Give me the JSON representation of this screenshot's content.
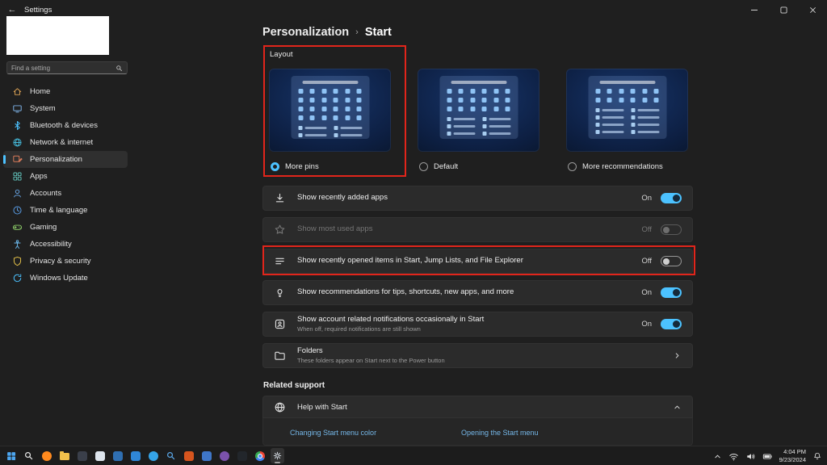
{
  "colors": {
    "accent": "#4cc2ff",
    "link": "#75b7e8",
    "annotation": "#e1251b"
  },
  "titlebar": {
    "title": "Settings"
  },
  "sidebar": {
    "search_placeholder": "Find a setting",
    "items": [
      {
        "label": "Home",
        "icon": "home"
      },
      {
        "label": "System",
        "icon": "system"
      },
      {
        "label": "Bluetooth & devices",
        "icon": "bluetooth"
      },
      {
        "label": "Network & internet",
        "icon": "network"
      },
      {
        "label": "Personalization",
        "icon": "personalization",
        "selected": true
      },
      {
        "label": "Apps",
        "icon": "apps"
      },
      {
        "label": "Accounts",
        "icon": "accounts"
      },
      {
        "label": "Time & language",
        "icon": "time"
      },
      {
        "label": "Gaming",
        "icon": "gaming"
      },
      {
        "label": "Accessibility",
        "icon": "accessibility"
      },
      {
        "label": "Privacy & security",
        "icon": "privacy"
      },
      {
        "label": "Windows Update",
        "icon": "update"
      }
    ]
  },
  "breadcrumb": {
    "parent": "Personalization",
    "separator": "›",
    "current": "Start"
  },
  "layout": {
    "label": "Layout",
    "options": [
      {
        "label": "More pins",
        "selected": true,
        "pin_rows": 4,
        "rec_rows": 2
      },
      {
        "label": "Default",
        "selected": false,
        "pin_rows": 3,
        "rec_rows": 3
      },
      {
        "label": "More recommendations",
        "selected": false,
        "pin_rows": 2,
        "rec_rows": 4
      }
    ]
  },
  "settings": [
    {
      "icon": "download",
      "title": "Show recently added apps",
      "state": "On",
      "on": true,
      "disabled": false
    },
    {
      "icon": "star",
      "title": "Show most used apps",
      "state": "Off",
      "on": false,
      "disabled": true
    },
    {
      "icon": "list",
      "title": "Show recently opened items in Start, Jump Lists, and File Explorer",
      "state": "Off",
      "on": false,
      "disabled": false,
      "annotated": true
    },
    {
      "icon": "bulb",
      "title": "Show recommendations for tips, shortcuts, new apps, and more",
      "state": "On",
      "on": true,
      "disabled": false
    },
    {
      "icon": "account",
      "title": "Show account related notifications occasionally in Start",
      "subtitle": "When off, required notifications are still shown",
      "state": "On",
      "on": true,
      "disabled": false
    },
    {
      "icon": "folder",
      "title": "Folders",
      "subtitle": "These folders appear on Start next to the Power button",
      "chevron": true
    }
  ],
  "related": {
    "label": "Related support",
    "help_title": "Help with Start",
    "links": [
      "Changing Start menu color",
      "Opening the Start menu"
    ]
  },
  "taskbar": {
    "apps": [
      {
        "name": "start",
        "type": "win",
        "color": "#4da6f0"
      },
      {
        "name": "search",
        "type": "magnifier",
        "color": "#e8e8e8"
      },
      {
        "name": "firefox",
        "type": "circle",
        "color": "#ff8a1e"
      },
      {
        "name": "file-explorer",
        "type": "folder",
        "color": "#f2c14b"
      },
      {
        "name": "media-player",
        "type": "square",
        "color": "#3a3f4a"
      },
      {
        "name": "photos",
        "type": "square",
        "color": "#dde4ec"
      },
      {
        "name": "mail",
        "type": "square",
        "color": "#2f6fb2"
      },
      {
        "name": "store",
        "type": "square",
        "color": "#2f86d6"
      },
      {
        "name": "edge",
        "type": "circle",
        "color": "#35a4e8"
      },
      {
        "name": "search-app",
        "type": "magnifier",
        "color": "#5aa7e8"
      },
      {
        "name": "powerpoint",
        "type": "square",
        "color": "#d6551e"
      },
      {
        "name": "notepad",
        "type": "square",
        "color": "#3f76c8"
      },
      {
        "name": "visual-studio",
        "type": "circle",
        "color": "#7b52ab"
      },
      {
        "name": "terminal",
        "type": "square",
        "color": "#22262b"
      },
      {
        "name": "chrome",
        "type": "chrome",
        "color": ""
      },
      {
        "name": "settings",
        "type": "gear",
        "color": "#cfd6dd",
        "active": true
      }
    ],
    "tray": [
      "chevron-up",
      "wifi",
      "volume",
      "battery"
    ],
    "clock": {
      "time": "4:04 PM",
      "date": "9/23/2024"
    },
    "bell": "notification-bell"
  }
}
